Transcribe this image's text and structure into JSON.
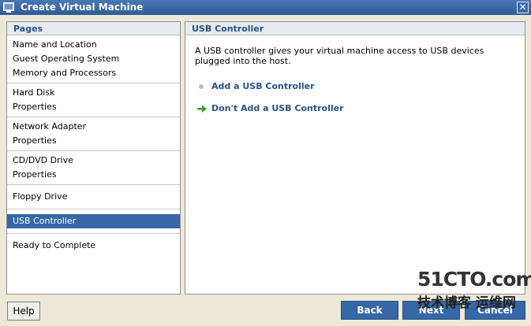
{
  "window": {
    "title": "Create Virtual Machine",
    "close_glyph": "✕"
  },
  "pages": {
    "header": "Pages",
    "groups": [
      [
        "Name and Location",
        "Guest Operating System",
        "Memory and Processors"
      ],
      [
        "Hard Disk",
        "Properties"
      ],
      [
        "Network Adapter",
        "Properties"
      ],
      [
        "CD/DVD Drive",
        "Properties"
      ],
      [
        "Floppy Drive"
      ],
      [
        "USB Controller"
      ],
      [
        "Ready to Complete"
      ]
    ],
    "selected": "USB Controller"
  },
  "main": {
    "header": "USB Controller",
    "description": "A USB controller gives your virtual machine access to USB devices plugged into the host.",
    "options": [
      {
        "label": "Add a USB Controller",
        "icon": "bullet-icon"
      },
      {
        "label": "Don't Add a USB Controller",
        "icon": "green-arrow-icon"
      }
    ]
  },
  "buttons": {
    "help": "Help",
    "back": "Back",
    "next": "Next",
    "cancel": "Cancel"
  },
  "watermark": {
    "main": "51CTO.com",
    "sub": "技术博客  运维网"
  },
  "colors": {
    "accent": "#3667a6",
    "header_text": "#2a5285",
    "arrow": "#2e9e2e"
  }
}
